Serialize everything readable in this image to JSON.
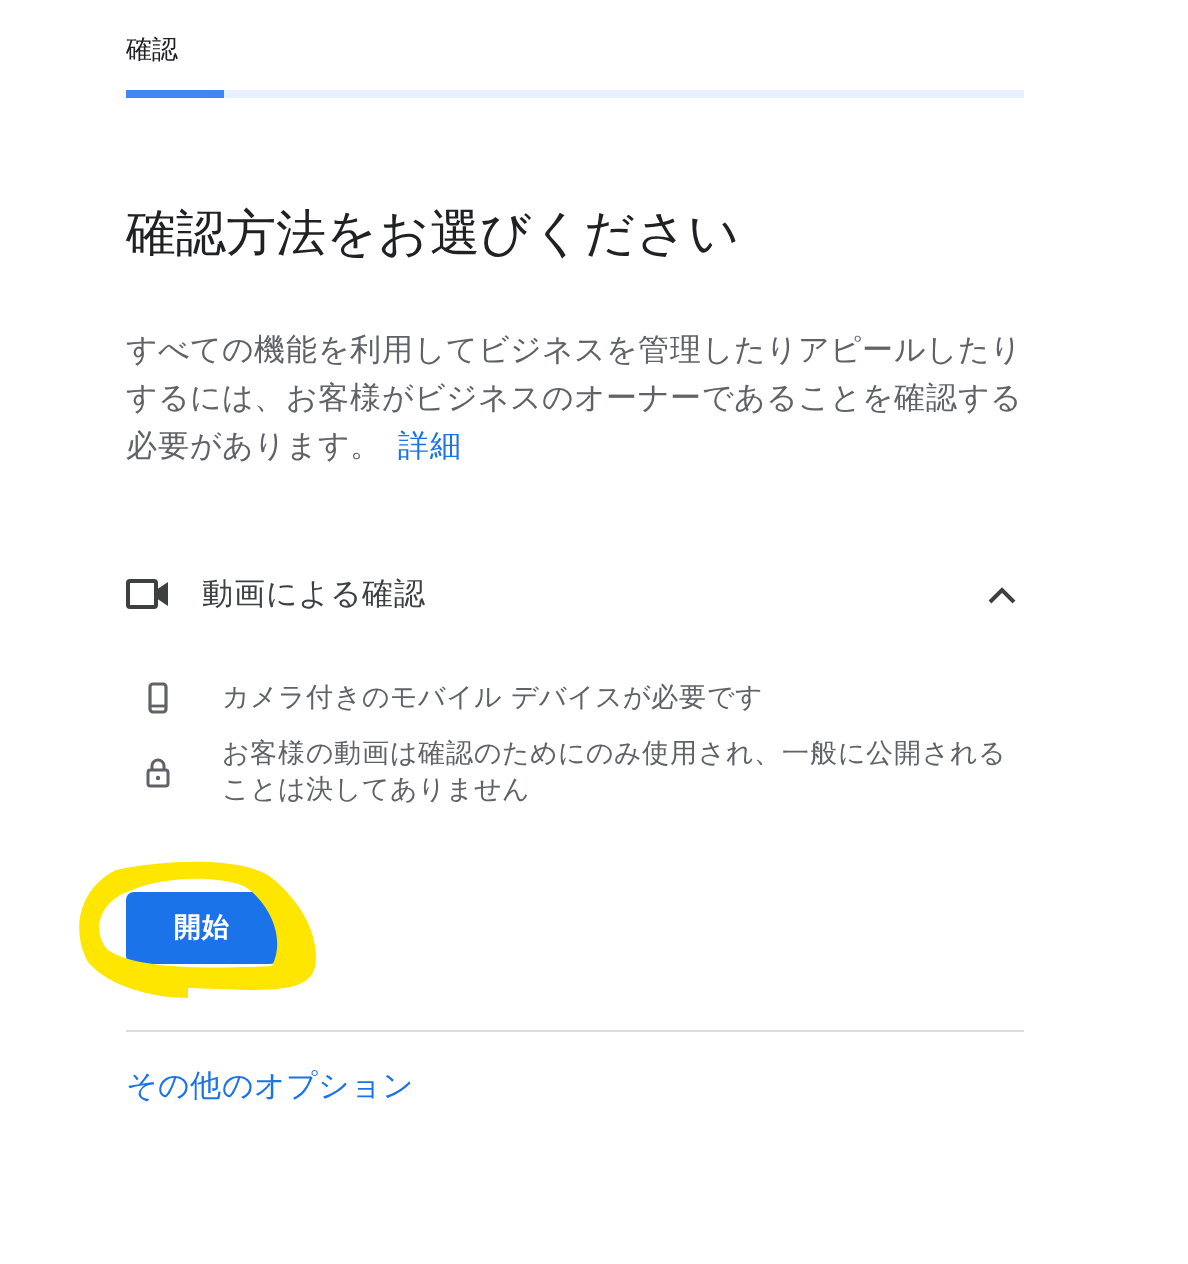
{
  "step": {
    "title": "確認",
    "level": 0.11
  },
  "heading": "確認方法をお選びください",
  "description": {
    "text": "すべての機能を利用してビジネスを管理したりアピールしたりするには、お客様がビジネスのオーナーであることを確認する必要があります。",
    "link": "詳細"
  },
  "method": {
    "title": "動画による確認",
    "expanded": true,
    "items": [
      {
        "kind": "phone",
        "text": "カメラ付きのモバイル デバイスが必要です"
      },
      {
        "kind": "lock",
        "text": "お客様の動画は確認のためにのみ使用され、一般に公開されることは決してありません"
      }
    ]
  },
  "start_button": "開始",
  "other_options": "その他のオプション"
}
